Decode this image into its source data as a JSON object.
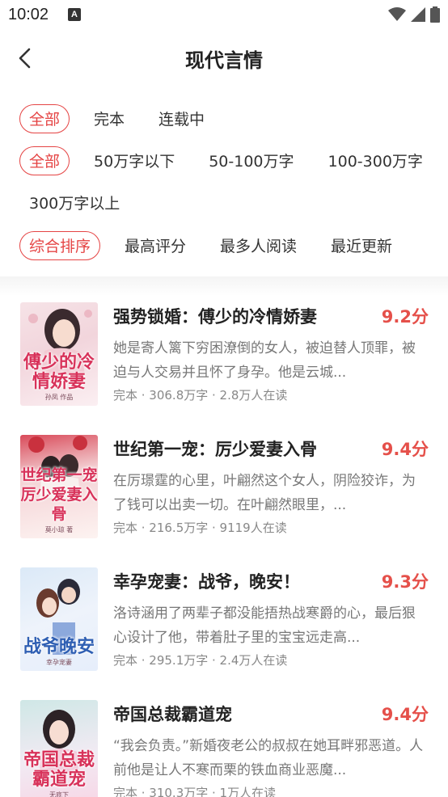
{
  "status_bar": {
    "time": "10:02",
    "notification_glyph": "A"
  },
  "header": {
    "title": "现代言情"
  },
  "filters": {
    "status": [
      "全部",
      "完本",
      "连载中"
    ],
    "word_count": [
      "全部",
      "50万字以下",
      "50-100万字",
      "100-300万字",
      "300万字以上"
    ],
    "sort": [
      "综合排序",
      "最高评分",
      "最多人阅读",
      "最近更新"
    ]
  },
  "selected": {
    "status": "全部",
    "word_count": "全部",
    "sort": "综合排序"
  },
  "accent_color": "#e54444",
  "books": [
    {
      "title": "强势锁婚：傅少的冷情娇妻",
      "score": "9.2分",
      "desc": "她是寄人篱下穷困潦倒的女人，被迫替人顶罪，被迫与人交易并且怀了身孕。他是云城...",
      "meta": "完本 · 306.8万字 · 2.8万人在读",
      "cover_title": "傅少的冷情娇妻",
      "cover_sub": "孙凤 作品"
    },
    {
      "title": "世纪第一宠：厉少爱妻入骨",
      "score": "9.4分",
      "desc": "在厉璟霆的心里，叶翩然这个女人，阴险狡诈，为了钱可以出卖一切。在叶翩然眼里，...",
      "meta": "完本 · 216.5万字 · 9119人在读",
      "cover_title": "世纪第一宠厉少爱妻入骨",
      "cover_sub": "莫小琼 著"
    },
    {
      "title": "幸孕宠妻：战爷，晚安！",
      "score": "9.3分",
      "desc": "洛诗涵用了两辈子都没能捂热战寒爵的心，最后狠心设计了他，带着肚子里的宝宝远走高...",
      "meta": "完本 · 295.1万字 · 2.4万人在读",
      "cover_title": "战爷晚安",
      "cover_sub": "幸孕宠妻"
    },
    {
      "title": "帝国总裁霸道宠",
      "score": "9.4分",
      "desc": "“我会负责。”新婚夜老公的叔叔在她耳畔邪恶道。人前他是让人不寒而栗的铁血商业恶魔...",
      "meta": "完本 · 310.3万字 · 1万人在读",
      "cover_title": "帝国总裁霸道宠",
      "cover_sub": "无底下"
    }
  ]
}
